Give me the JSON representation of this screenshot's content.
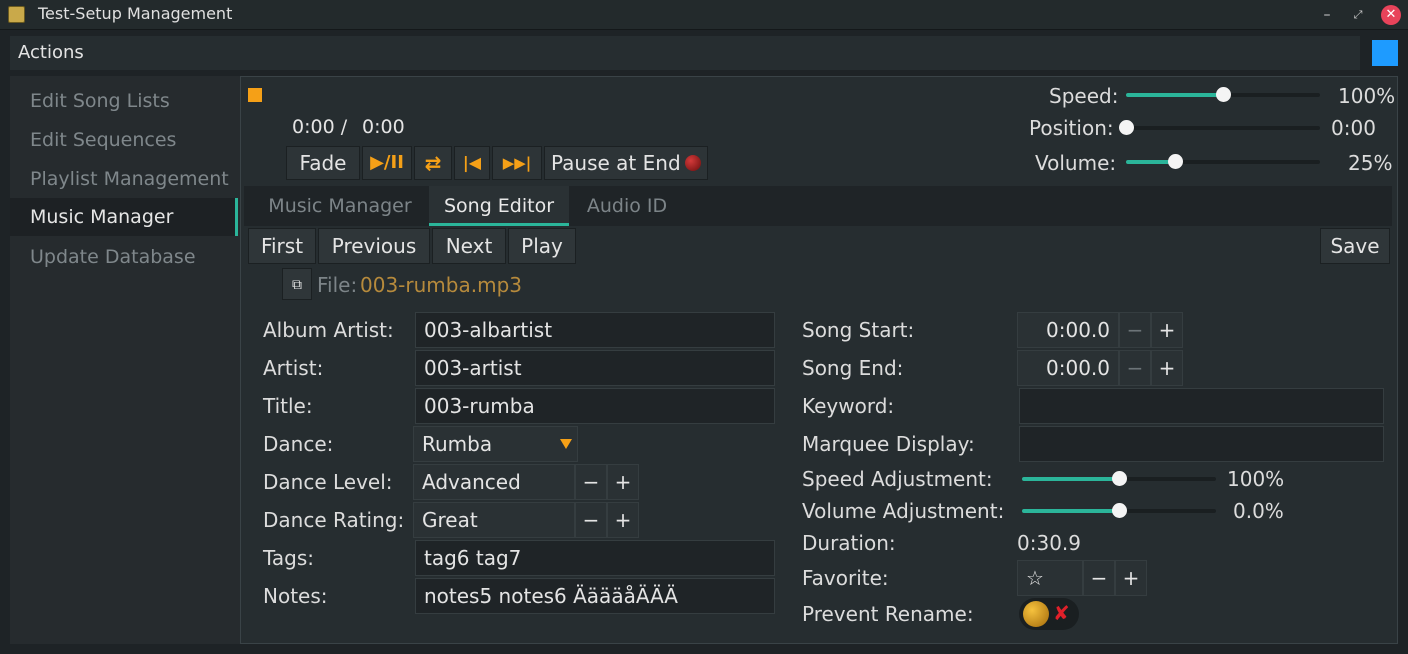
{
  "window": {
    "title": "Test-Setup Management",
    "minimize": "–",
    "maximize": "⤢",
    "close": "✕"
  },
  "menu": {
    "actions": "Actions"
  },
  "sidebar": {
    "items": [
      {
        "label": "Edit Song Lists"
      },
      {
        "label": "Edit Sequences"
      },
      {
        "label": "Playlist Management"
      },
      {
        "label": "Music Manager"
      },
      {
        "label": "Update Database"
      }
    ]
  },
  "player": {
    "time_current": "0:00 /",
    "time_total": "0:00",
    "fade": "Fade",
    "play_pause": "▶/II",
    "loop": "⇄",
    "prev": "|◀",
    "next": "▶▶|",
    "pause_at_end": "Pause at End",
    "speed_label": "Speed:",
    "speed_value": "100%",
    "speed_fraction": 0.5,
    "position_label": "Position:",
    "position_value": "0:00",
    "position_fraction": 0.0,
    "volume_label": "Volume:",
    "volume_value": "25%",
    "volume_fraction": 0.25
  },
  "tabs": [
    {
      "label": "Music Manager"
    },
    {
      "label": "Song Editor"
    },
    {
      "label": "Audio ID"
    }
  ],
  "editor": {
    "first": "First",
    "previous": "Previous",
    "next": "Next",
    "play": "Play",
    "save": "Save",
    "copy_icon": "⧉",
    "file_label": "File:",
    "file_name": "003-rumba.mp3",
    "album_artist_label": "Album Artist:",
    "album_artist": "003-albartist",
    "artist_label": "Artist:",
    "artist": "003-artist",
    "title_label": "Title:",
    "title": "003-rumba",
    "dance_label": "Dance:",
    "dance": "Rumba",
    "dance_level_label": "Dance Level:",
    "dance_level": "Advanced",
    "dance_rating_label": "Dance Rating:",
    "dance_rating": "Great",
    "tags_label": "Tags:",
    "tags": "tag6 tag7",
    "notes_label": "Notes:",
    "notes": "notes5 notes6  ÄäääåÄÄÄ",
    "song_start_label": "Song Start:",
    "song_start": "0:00.0",
    "song_end_label": "Song End:",
    "song_end": "0:00.0",
    "keyword_label": "Keyword:",
    "keyword": "",
    "marquee_label": "Marquee Display:",
    "marquee": "",
    "speed_adj_label": "Speed Adjustment:",
    "speed_adj_value": "100%",
    "speed_adj_fraction": 0.5,
    "volume_adj_label": "Volume Adjustment:",
    "volume_adj_value": "0.0%",
    "volume_adj_fraction": 0.5,
    "duration_label": "Duration:",
    "duration": "0:30.9",
    "favorite_label": "Favorite:",
    "favorite_star": "☆",
    "prevent_rename_label": "Prevent Rename:",
    "prevent_rename_x": "✘",
    "minus": "−",
    "plus": "+"
  },
  "colors": {
    "accent": "#2bb59a",
    "orange": "#f5a017",
    "blue": "#1e9bff"
  }
}
